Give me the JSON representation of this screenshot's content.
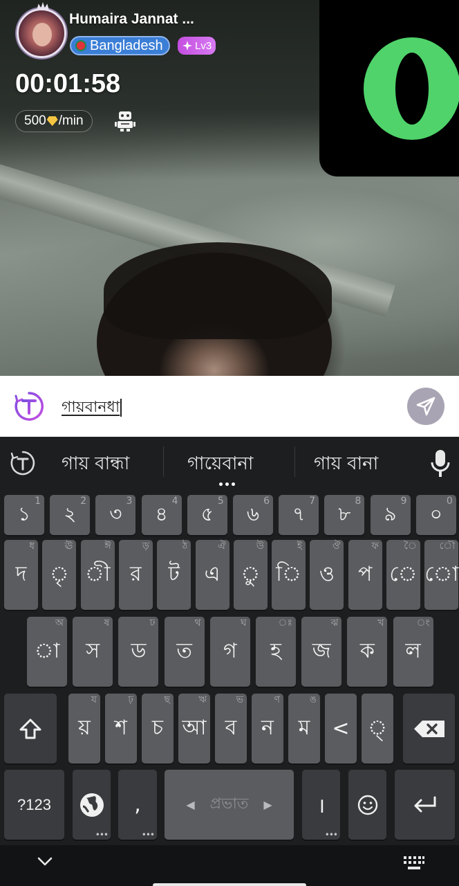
{
  "caller": {
    "name": "Humaira Jannat ...",
    "country": "Bangladesh",
    "level": "Lv3",
    "timer": "00:01:58",
    "rate_amount": "500",
    "rate_unit": "/min",
    "icons": {
      "avatar": "profile-photo",
      "flag": "bangladesh-flag",
      "level": "sparkle-icon",
      "rate": "diamond-icon",
      "robot": "robot-icon"
    }
  },
  "overlay": {
    "app": "opera-logo",
    "background": "#000000",
    "logo_color": "#4fd36a"
  },
  "composer": {
    "text": "গায়বানধা",
    "translate_icon": "translate-icon",
    "send_icon": "send-icon"
  },
  "keyboard": {
    "suggestions": [
      "গায় বান্ধা",
      "গায়েবানা",
      "গায় বানা"
    ],
    "toolbar_icons": {
      "left": "translate-icon",
      "right": "microphone-icon"
    },
    "number_row": [
      {
        "key": "১",
        "hint": "1"
      },
      {
        "key": "২",
        "hint": "2"
      },
      {
        "key": "৩",
        "hint": "3"
      },
      {
        "key": "৪",
        "hint": "4"
      },
      {
        "key": "৫",
        "hint": "5"
      },
      {
        "key": "৬",
        "hint": "6"
      },
      {
        "key": "৭",
        "hint": "7"
      },
      {
        "key": "৮",
        "hint": "8"
      },
      {
        "key": "৯",
        "hint": "9"
      },
      {
        "key": "০",
        "hint": "0"
      }
    ],
    "row1": [
      {
        "key": "দ",
        "hint": "ধ"
      },
      {
        "key": "ৃ",
        "hint": "ঊ"
      },
      {
        "key": "ী",
        "hint": "ঈ"
      },
      {
        "key": "র",
        "hint": "ড়"
      },
      {
        "key": "ট",
        "hint": "ঠ"
      },
      {
        "key": "এ",
        "hint": "ঐ"
      },
      {
        "key": "ু",
        "hint": "উ"
      },
      {
        "key": "ি",
        "hint": "ই"
      },
      {
        "key": "ও",
        "hint": "ঔ"
      },
      {
        "key": "প",
        "hint": "ফ"
      },
      {
        "key": "ে",
        "hint": "ৈ"
      },
      {
        "key": "ো",
        "hint": "ৌ"
      }
    ],
    "row2": [
      {
        "key": "া",
        "hint": "অ"
      },
      {
        "key": "স",
        "hint": "ষ"
      },
      {
        "key": "ড",
        "hint": "ঢ"
      },
      {
        "key": "ত",
        "hint": "থ"
      },
      {
        "key": "গ",
        "hint": "ঘ"
      },
      {
        "key": "হ",
        "hint": "ঃ"
      },
      {
        "key": "জ",
        "hint": "ঝ"
      },
      {
        "key": "ক",
        "hint": "খ"
      },
      {
        "key": "ল",
        "hint": "ং"
      }
    ],
    "row3": [
      {
        "key": "য়",
        "hint": "য"
      },
      {
        "key": "শ",
        "hint": "ঢ়"
      },
      {
        "key": "চ",
        "hint": "ছ"
      },
      {
        "key": "আ",
        "hint": "ঋ"
      },
      {
        "key": "ব",
        "hint": "ভ"
      },
      {
        "key": "ন",
        "hint": "ণ"
      },
      {
        "key": "ম",
        "hint": "ঙ"
      },
      {
        "key": "<",
        "hint": ""
      },
      {
        "key": "্",
        "hint": ""
      }
    ],
    "symbols_label": "?123",
    "comma": ",",
    "space_label": "প্রভাত",
    "danda": "।",
    "icons": {
      "shift": "shift-icon",
      "backspace": "backspace-icon",
      "globe": "globe-icon",
      "emoji": "emoji-icon",
      "enter": "enter-icon"
    },
    "nav_icons": {
      "collapse": "chevron-down-icon",
      "switch": "keyboard-icon"
    }
  }
}
